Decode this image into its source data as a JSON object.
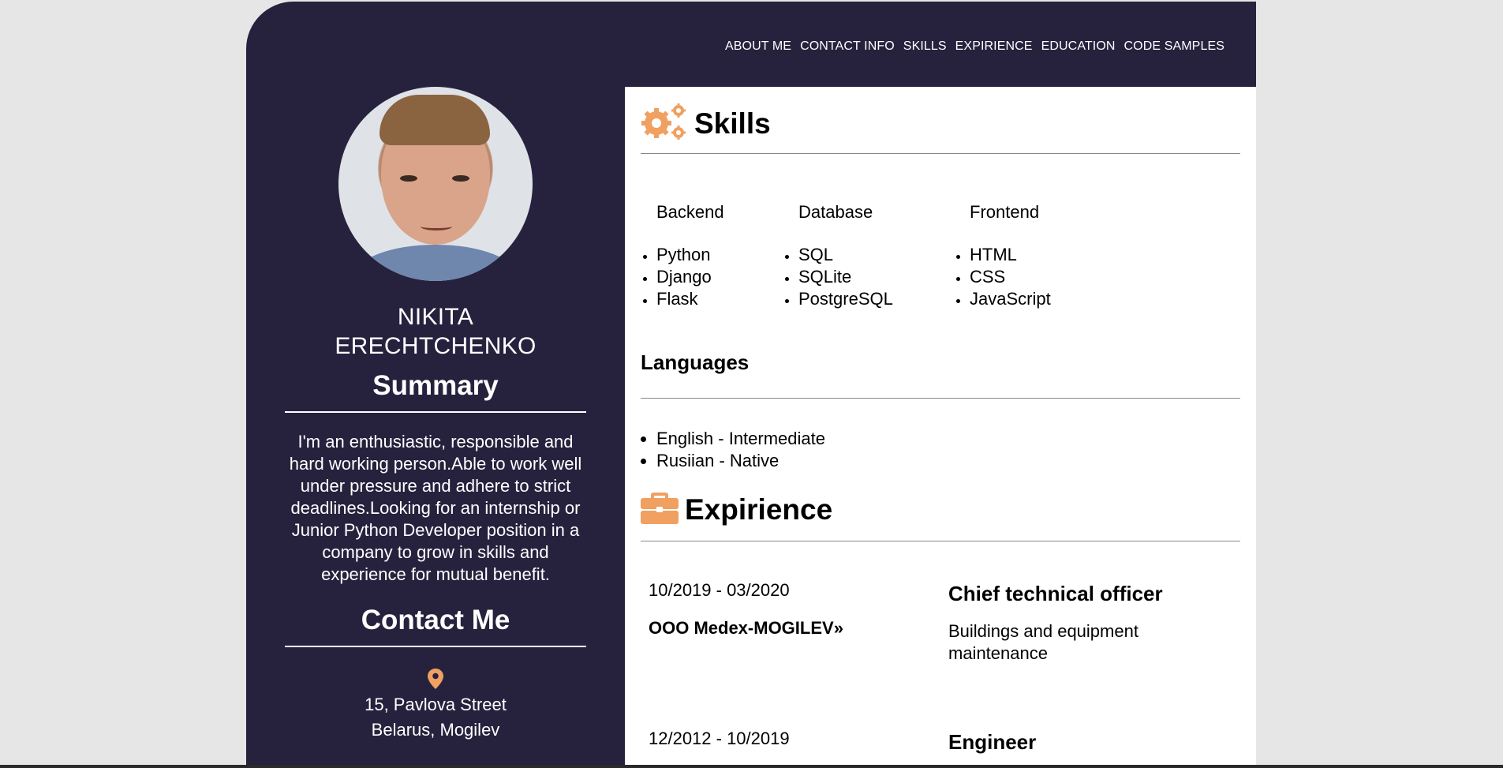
{
  "colors": {
    "sidebar": "#26223e",
    "accent": "#f0a060",
    "main_bg": "#ffffff",
    "page_bg": "#e6e6e6"
  },
  "nav": [
    "ABOUT ME",
    "CONTACT INFO",
    "SKILLS",
    "EXPIRIENCE",
    "EDUCATION",
    "CODE SAMPLES"
  ],
  "sidebar": {
    "avatar": "profile-photo",
    "name_first": "NIKITA",
    "name_last": "ERECHTCHENKO",
    "summary_title": "Summary",
    "summary_text": "I'm an enthusiastic, responsible and hard working person.Able to work well under pressure and adhere to strict deadlines.Looking for an internship or Junior Python Developer position in a company to grow in skills and experience for mutual benefit.",
    "contact_title": "Contact Me",
    "pin_icon": "map-pin-icon",
    "address_line1": "15, Pavlova Street",
    "address_line2": "Belarus, Mogilev"
  },
  "skills": {
    "title": "Skills",
    "icon": "gears-icon",
    "columns": [
      {
        "heading": "Backend",
        "items": [
          "Python",
          "Django",
          "Flask"
        ]
      },
      {
        "heading": "Database",
        "items": [
          "SQL",
          "SQLite",
          "PostgreSQL"
        ]
      },
      {
        "heading": "Frontend",
        "items": [
          "HTML",
          "CSS",
          "JavaScript"
        ]
      }
    ]
  },
  "languages": {
    "title": "Languages",
    "items": [
      "English - Intermediate",
      "Rusiian - Native"
    ]
  },
  "experience": {
    "title": "Expirience",
    "icon": "briefcase-icon",
    "items": [
      {
        "dates": "10/2019 - 03/2020",
        "company": "OOO Medex-MOGILEV»",
        "role": "Chief technical officer",
        "desc": "Buildings and equipment maintenance"
      },
      {
        "dates": "12/2012 - 10/2019",
        "company": "",
        "role": "Engineer",
        "desc": ""
      }
    ]
  }
}
